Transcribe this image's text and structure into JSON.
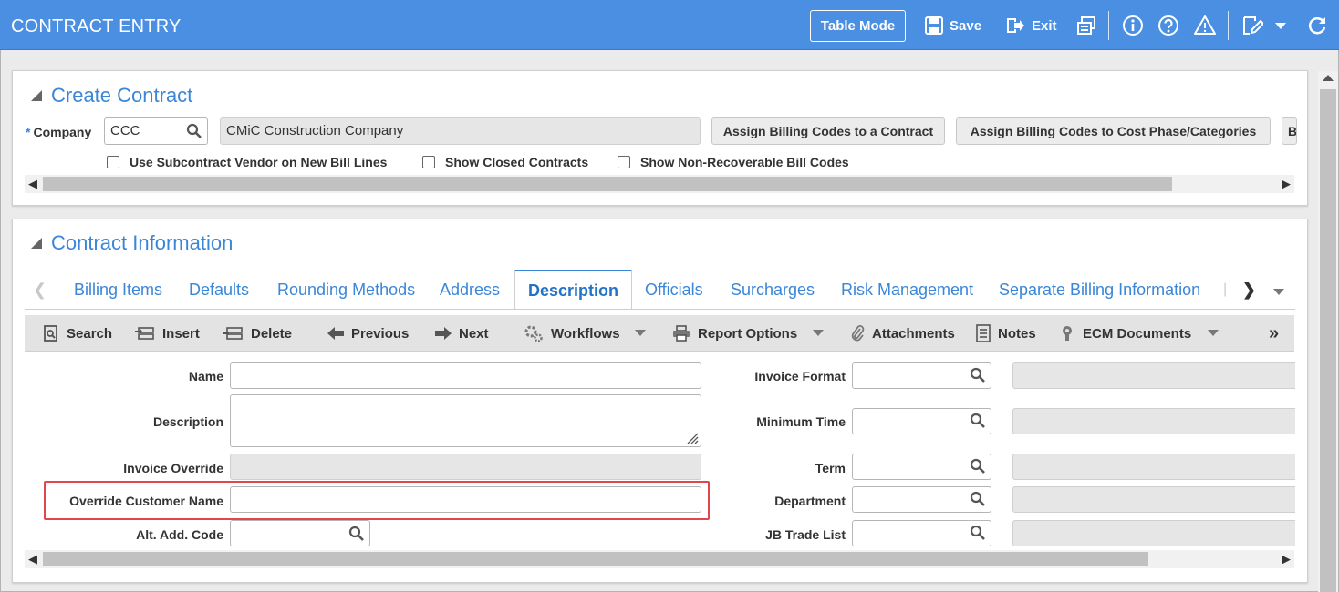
{
  "header": {
    "title": "CONTRACT ENTRY",
    "table_mode": "Table Mode",
    "save": "Save",
    "exit": "Exit"
  },
  "create_contract": {
    "title": "Create Contract",
    "required_mark": "*",
    "company_label": "Company",
    "company_value": "CCC",
    "company_name": "CMiC Construction Company",
    "buttons": [
      "Assign Billing Codes to a Contract",
      "Assign Billing Codes to Cost Phase/Categories",
      "B"
    ],
    "checkboxes": [
      "Use Subcontract Vendor on New Bill Lines",
      "Show Closed Contracts",
      "Show Non-Recoverable Bill Codes"
    ]
  },
  "contract_info": {
    "title": "Contract Information",
    "tabs": [
      "Billing Items",
      "Defaults",
      "Rounding Methods",
      "Address",
      "Description",
      "Officials",
      "Surcharges",
      "Risk Management",
      "Separate Billing Information"
    ],
    "active_tab": "Description"
  },
  "toolbar": {
    "search": "Search",
    "insert": "Insert",
    "delete": "Delete",
    "previous": "Previous",
    "next": "Next",
    "workflows": "Workflows",
    "report_options": "Report Options",
    "attachments": "Attachments",
    "notes": "Notes",
    "ecm_documents": "ECM Documents"
  },
  "form_left": {
    "name_label": "Name",
    "description_label": "Description",
    "invoice_override_label": "Invoice Override",
    "override_customer_label": "Override Customer Name",
    "alt_add_code_label": "Alt. Add. Code"
  },
  "form_right": {
    "invoice_format_label": "Invoice Format",
    "minimum_time_label": "Minimum Time",
    "term_label": "Term",
    "department_label": "Department",
    "jb_trade_list_label": "JB Trade List"
  },
  "colors": {
    "header_bg": "#4a8fe2",
    "accent": "#3a86d8",
    "highlight": "#e0474c"
  }
}
